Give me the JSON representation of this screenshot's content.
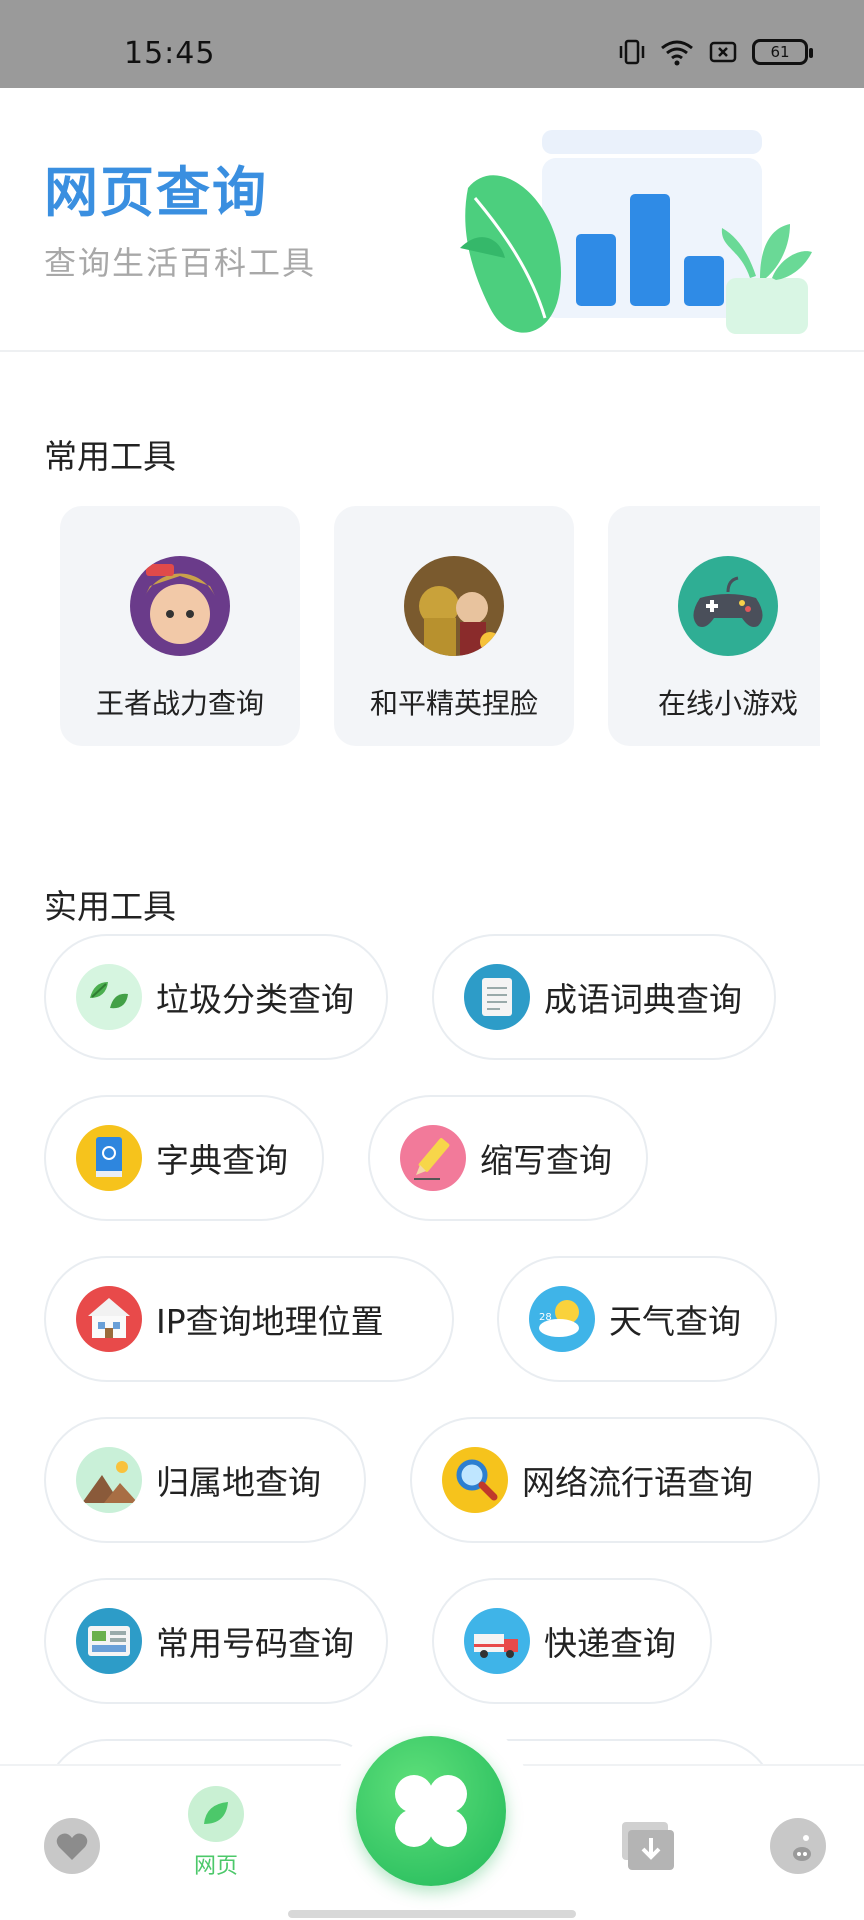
{
  "status_bar": {
    "time": "15:45",
    "battery": "61"
  },
  "header": {
    "title": "网页查询",
    "subtitle": "查询生活百科工具"
  },
  "sections": {
    "common_title": "常用工具",
    "practical_title": "实用工具"
  },
  "common_tools": [
    {
      "label": "王者战力查询",
      "icon": "game-avatar-icon"
    },
    {
      "label": "和平精英捏脸",
      "icon": "soldier-avatar-icon"
    },
    {
      "label": "在线小游戏",
      "icon": "gamepad-icon"
    }
  ],
  "practical_tools": [
    {
      "label": "垃圾分类查询",
      "icon": "leaf-icon"
    },
    {
      "label": "成语词典查询",
      "icon": "notebook-icon"
    },
    {
      "label": "字典查询",
      "icon": "book-icon"
    },
    {
      "label": "缩写查询",
      "icon": "pencil-icon"
    },
    {
      "label": "IP查询地理位置",
      "icon": "house-icon"
    },
    {
      "label": "天气查询",
      "icon": "weather-icon"
    },
    {
      "label": "归属地查询",
      "icon": "mountain-icon"
    },
    {
      "label": "网络流行语查询",
      "icon": "magnifier-icon"
    },
    {
      "label": "常用号码查询",
      "icon": "phonebook-icon"
    },
    {
      "label": "快递查询",
      "icon": "truck-icon"
    }
  ],
  "bottom_nav": {
    "web_label": "网页"
  },
  "colors": {
    "accent_blue": "#3a8fe0",
    "accent_green": "#4cc86a"
  }
}
